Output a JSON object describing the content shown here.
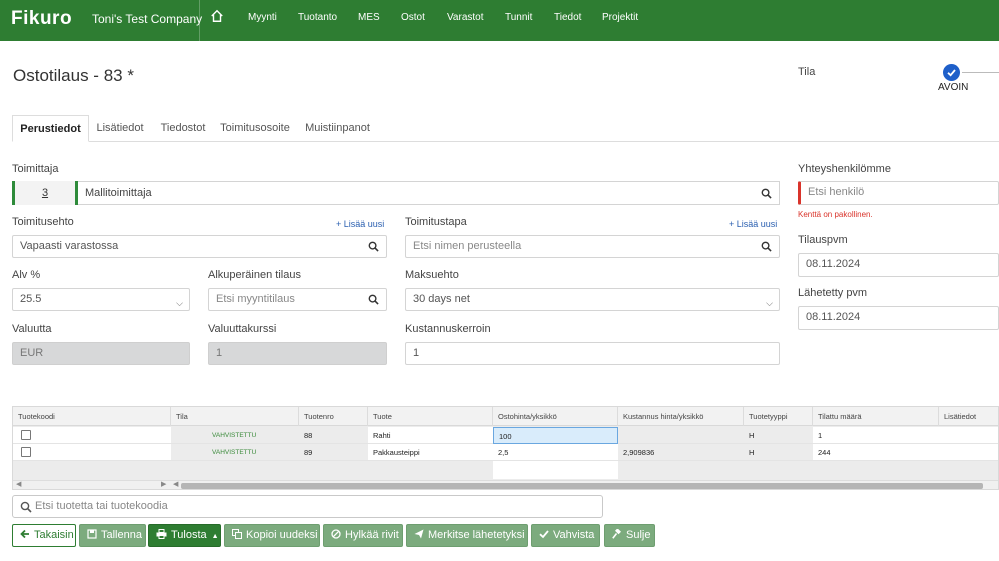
{
  "app": {
    "brand": "Fikuro",
    "company": "Toni's Test Company",
    "nav": [
      "Myynti",
      "Tuotanto",
      "MES",
      "Ostot",
      "Varastot",
      "Tunnit",
      "Tiedot",
      "Projektit"
    ]
  },
  "page": {
    "title": "Ostotilaus - 83 *"
  },
  "status": {
    "label": "Tila",
    "value": "AVOIN"
  },
  "tabs": [
    "Perustiedot",
    "Lisätiedot",
    "Tiedostot",
    "Toimitusosoite",
    "Muistiinpanot"
  ],
  "form": {
    "supplier_label": "Toimittaja",
    "supplier_number": "3",
    "supplier_name": "Mallitoimittaja",
    "contact_label": "Yhteyshenkilömme",
    "contact_placeholder": "Etsi henkilö",
    "contact_error": "Kenttä on pakollinen.",
    "delivery_terms_label": "Toimitusehto",
    "delivery_terms_value": "Vapaasti varastossa",
    "delivery_method_label": "Toimitustapa",
    "delivery_method_placeholder": "Etsi nimen perusteella",
    "add_new": "+ Lisää uusi",
    "order_date_label": "Tilauspvm",
    "order_date_value": "08.11.2024",
    "vat_label": "Alv %",
    "vat_value": "25.5",
    "original_order_label": "Alkuperäinen tilaus",
    "original_order_placeholder": "Etsi myyntitilaus",
    "payment_terms_label": "Maksuehto",
    "payment_terms_value": "30 days net",
    "sent_date_label": "Lähetetty pvm",
    "sent_date_value": "08.11.2024",
    "currency_label": "Valuutta",
    "currency_value": "EUR",
    "rate_label": "Valuuttakurssi",
    "rate_value": "1",
    "cost_factor_label": "Kustannuskerroin",
    "cost_factor_value": "1"
  },
  "grid": {
    "headers": [
      "Tuotekoodi",
      "Tila",
      "Tuotenro",
      "Tuote",
      "Ostohinta/yksikkö",
      "Kustannus hinta/yksikkö",
      "Tuotetyyppi",
      "Tilattu määrä",
      "Lisätiedot"
    ],
    "rows": [
      {
        "status": "VAHVISTETTU",
        "number": "88",
        "product": "Rahti",
        "price": "100",
        "cost": "",
        "type": "H",
        "qty": "1"
      },
      {
        "status": "VAHVISTETTU",
        "number": "89",
        "product": "Pakkausteippi",
        "price": "2,5",
        "cost": "2,909836",
        "type": "H",
        "qty": "244"
      }
    ]
  },
  "search": {
    "placeholder": "Etsi tuotetta tai tuotekoodia"
  },
  "actions": {
    "back": "Takaisin",
    "save": "Tallenna",
    "print": "Tulosta",
    "copy": "Kopioi uudeksi",
    "reject": "Hylkää rivit",
    "mark_sent": "Merkitse lähetetyksi",
    "confirm": "Vahvista",
    "close": "Sulje"
  }
}
